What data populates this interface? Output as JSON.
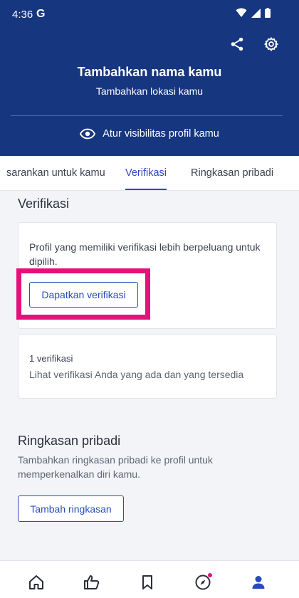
{
  "status_bar": {
    "time": "4:36",
    "google_badge": "G"
  },
  "header": {
    "profile_name": "Tambahkan nama kamu",
    "profile_location": "Tambahkan lokasi kamu",
    "visibility_label": "Atur visibilitas profil kamu",
    "icons": [
      "share-icon",
      "gear-icon",
      "eye-icon"
    ],
    "background_color": "#16367f"
  },
  "tabs": [
    {
      "label": "sarankan untuk kamu",
      "active": false
    },
    {
      "label": "Verifikasi",
      "active": true
    },
    {
      "label": "Ringkasan pribadi",
      "active": false
    }
  ],
  "verification": {
    "title": "Verifikasi",
    "description": "Profil yang memiliki verifikasi lebih berpeluang untuk dipilih.",
    "button_label": "Dapatkan verifikasi",
    "count_label": "1 verifikasi",
    "link_label": "Lihat verifikasi Anda yang ada dan yang tersedia"
  },
  "summary": {
    "title": "Ringkasan pribadi",
    "description": "Tambahkan ringkasan pribadi ke profil untuk memperkenalkan diri kamu.",
    "button_label": "Tambah ringkasan"
  },
  "bottom_nav": [
    {
      "icon": "home-icon",
      "active": false
    },
    {
      "icon": "thumbs-up-icon",
      "active": false
    },
    {
      "icon": "bookmark-icon",
      "active": false
    },
    {
      "icon": "compass-icon",
      "active": false,
      "badge": true
    },
    {
      "icon": "person-icon",
      "active": true
    }
  ],
  "colors": {
    "accent": "#2b4bbd",
    "highlight": "#e3127a",
    "page_background": "#f3f4f8"
  }
}
